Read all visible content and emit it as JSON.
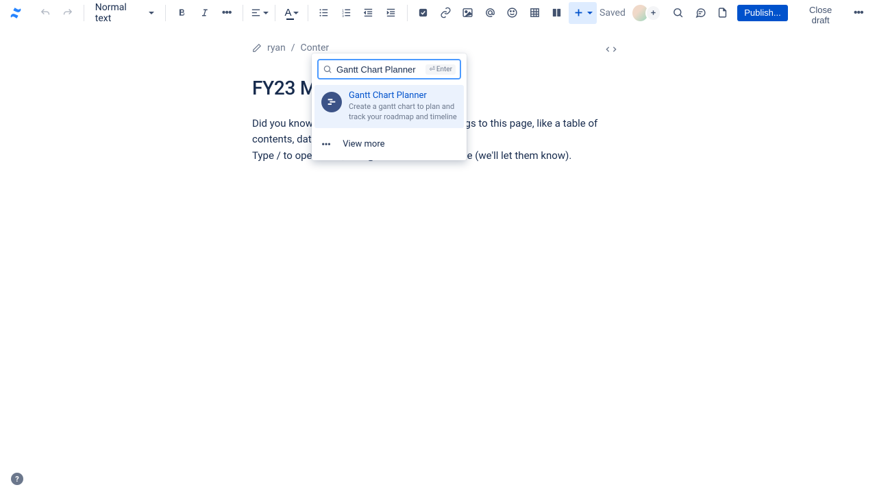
{
  "toolbar": {
    "text_style": "Normal text",
    "saved": "Saved",
    "publish": "Publish...",
    "close_draft": "Close draft"
  },
  "breadcrumb": {
    "user": "ryan",
    "page": "Conter"
  },
  "page": {
    "title": "FY23 Mar",
    "body_line1": "Did you know you can add all kinds of cool things to this page, like a table of contents, date, or roadmap?",
    "body_line2": "Type / to open a list, and @ to mention someone (we'll let them know)."
  },
  "popup": {
    "search_value": "Gantt Chart Planner",
    "enter_hint": "Enter",
    "result": {
      "title": "Gantt Chart Planner",
      "description": "Create a gantt chart to plan and track your roadmap and timeline"
    },
    "view_more": "View more"
  },
  "help": "?"
}
